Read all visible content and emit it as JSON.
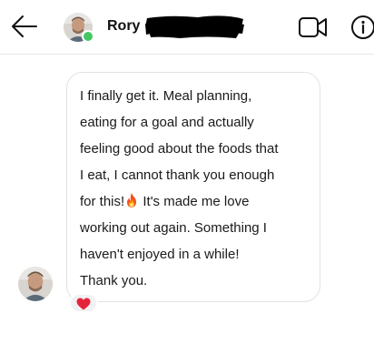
{
  "header": {
    "contact_name": "Rory",
    "contact_status": "online",
    "back_icon": "arrow-left-icon",
    "video_icon": "video-camera-icon",
    "info_icon": "info-icon"
  },
  "message": {
    "text_before_emoji": "I finally get it. Meal planning,\neating for a goal and actually\nfeeling good about the foods that\nI eat, I cannot thank you enough\nfor this!",
    "emoji": "fire-emoji",
    "text_after_emoji": " It's made me love\nworking out again. Something I\nhaven't enjoyed in a while!\nThank you.",
    "reaction_emoji": "red-heart-icon"
  },
  "colors": {
    "online_dot": "#44c763",
    "reaction_heart": "#e5243b",
    "bubble_border": "#e2e2e2",
    "header_divider": "#e6e6e6"
  }
}
